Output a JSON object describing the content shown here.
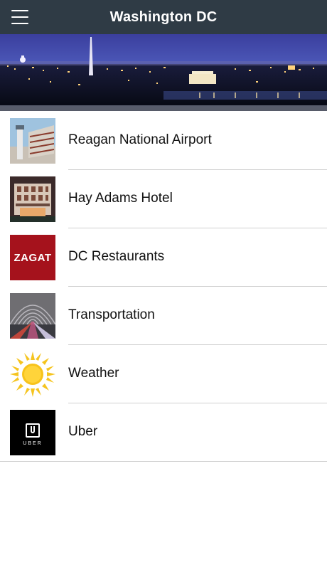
{
  "navbar": {
    "title": "Washington DC",
    "menu_icon": "hamburger-menu-icon",
    "background": "#2f3b45"
  },
  "banner": {
    "image": "washington-dc-skyline-night"
  },
  "items": [
    {
      "label": "Reagan National Airport",
      "icon": "airport-tower-thumbnail"
    },
    {
      "label": "Hay Adams Hotel",
      "icon": "hotel-building-thumbnail"
    },
    {
      "label": "DC Restaurants",
      "icon": "zagat-logo",
      "logo_text": "ZAGAT"
    },
    {
      "label": "Transportation",
      "icon": "metro-station-thumbnail"
    },
    {
      "label": "Weather",
      "icon": "sun-icon"
    },
    {
      "label": "Uber",
      "icon": "uber-logo",
      "logo_text": "UBER"
    }
  ]
}
